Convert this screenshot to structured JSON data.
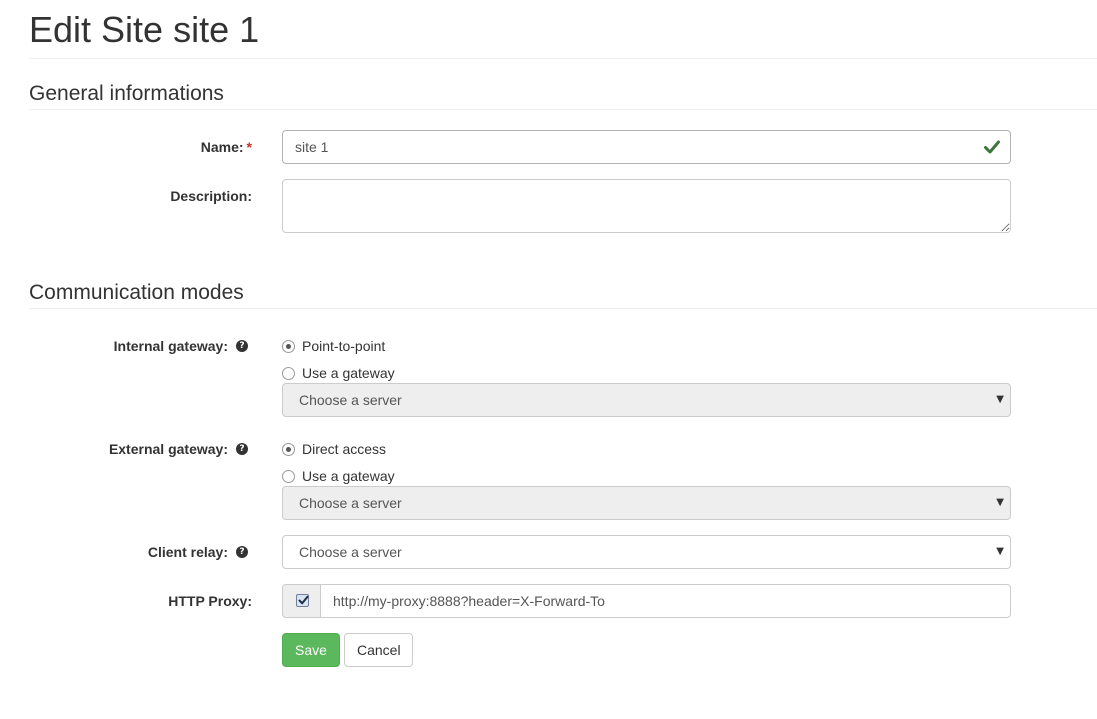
{
  "page": {
    "title": "Edit Site site 1"
  },
  "sections": {
    "general": "General informations",
    "communication": "Communication modes"
  },
  "fields": {
    "name": {
      "label": "Name:",
      "required_mark": "*",
      "value": "site 1"
    },
    "description": {
      "label": "Description:",
      "value": ""
    },
    "internal_gateway": {
      "label": "Internal gateway:",
      "options": [
        "Point-to-point",
        "Use a gateway"
      ],
      "selected": "Point-to-point",
      "server_select": "Choose a server"
    },
    "external_gateway": {
      "label": "External gateway:",
      "options": [
        "Direct access",
        "Use a gateway"
      ],
      "selected": "Direct access",
      "server_select": "Choose a server"
    },
    "client_relay": {
      "label": "Client relay:",
      "value": "Choose a server"
    },
    "http_proxy": {
      "label": "HTTP Proxy:",
      "enabled": true,
      "value": "http://my-proxy:8888?header=X-Forward-To"
    }
  },
  "buttons": {
    "save": "Save",
    "cancel": "Cancel"
  },
  "icons": {
    "help": "question-circle-icon",
    "valid": "check-icon",
    "caret": "caret-down-icon"
  },
  "colors": {
    "success": "#5cb85c",
    "valid_check": "#3c763d",
    "disabled_bg": "#eeeeee"
  }
}
